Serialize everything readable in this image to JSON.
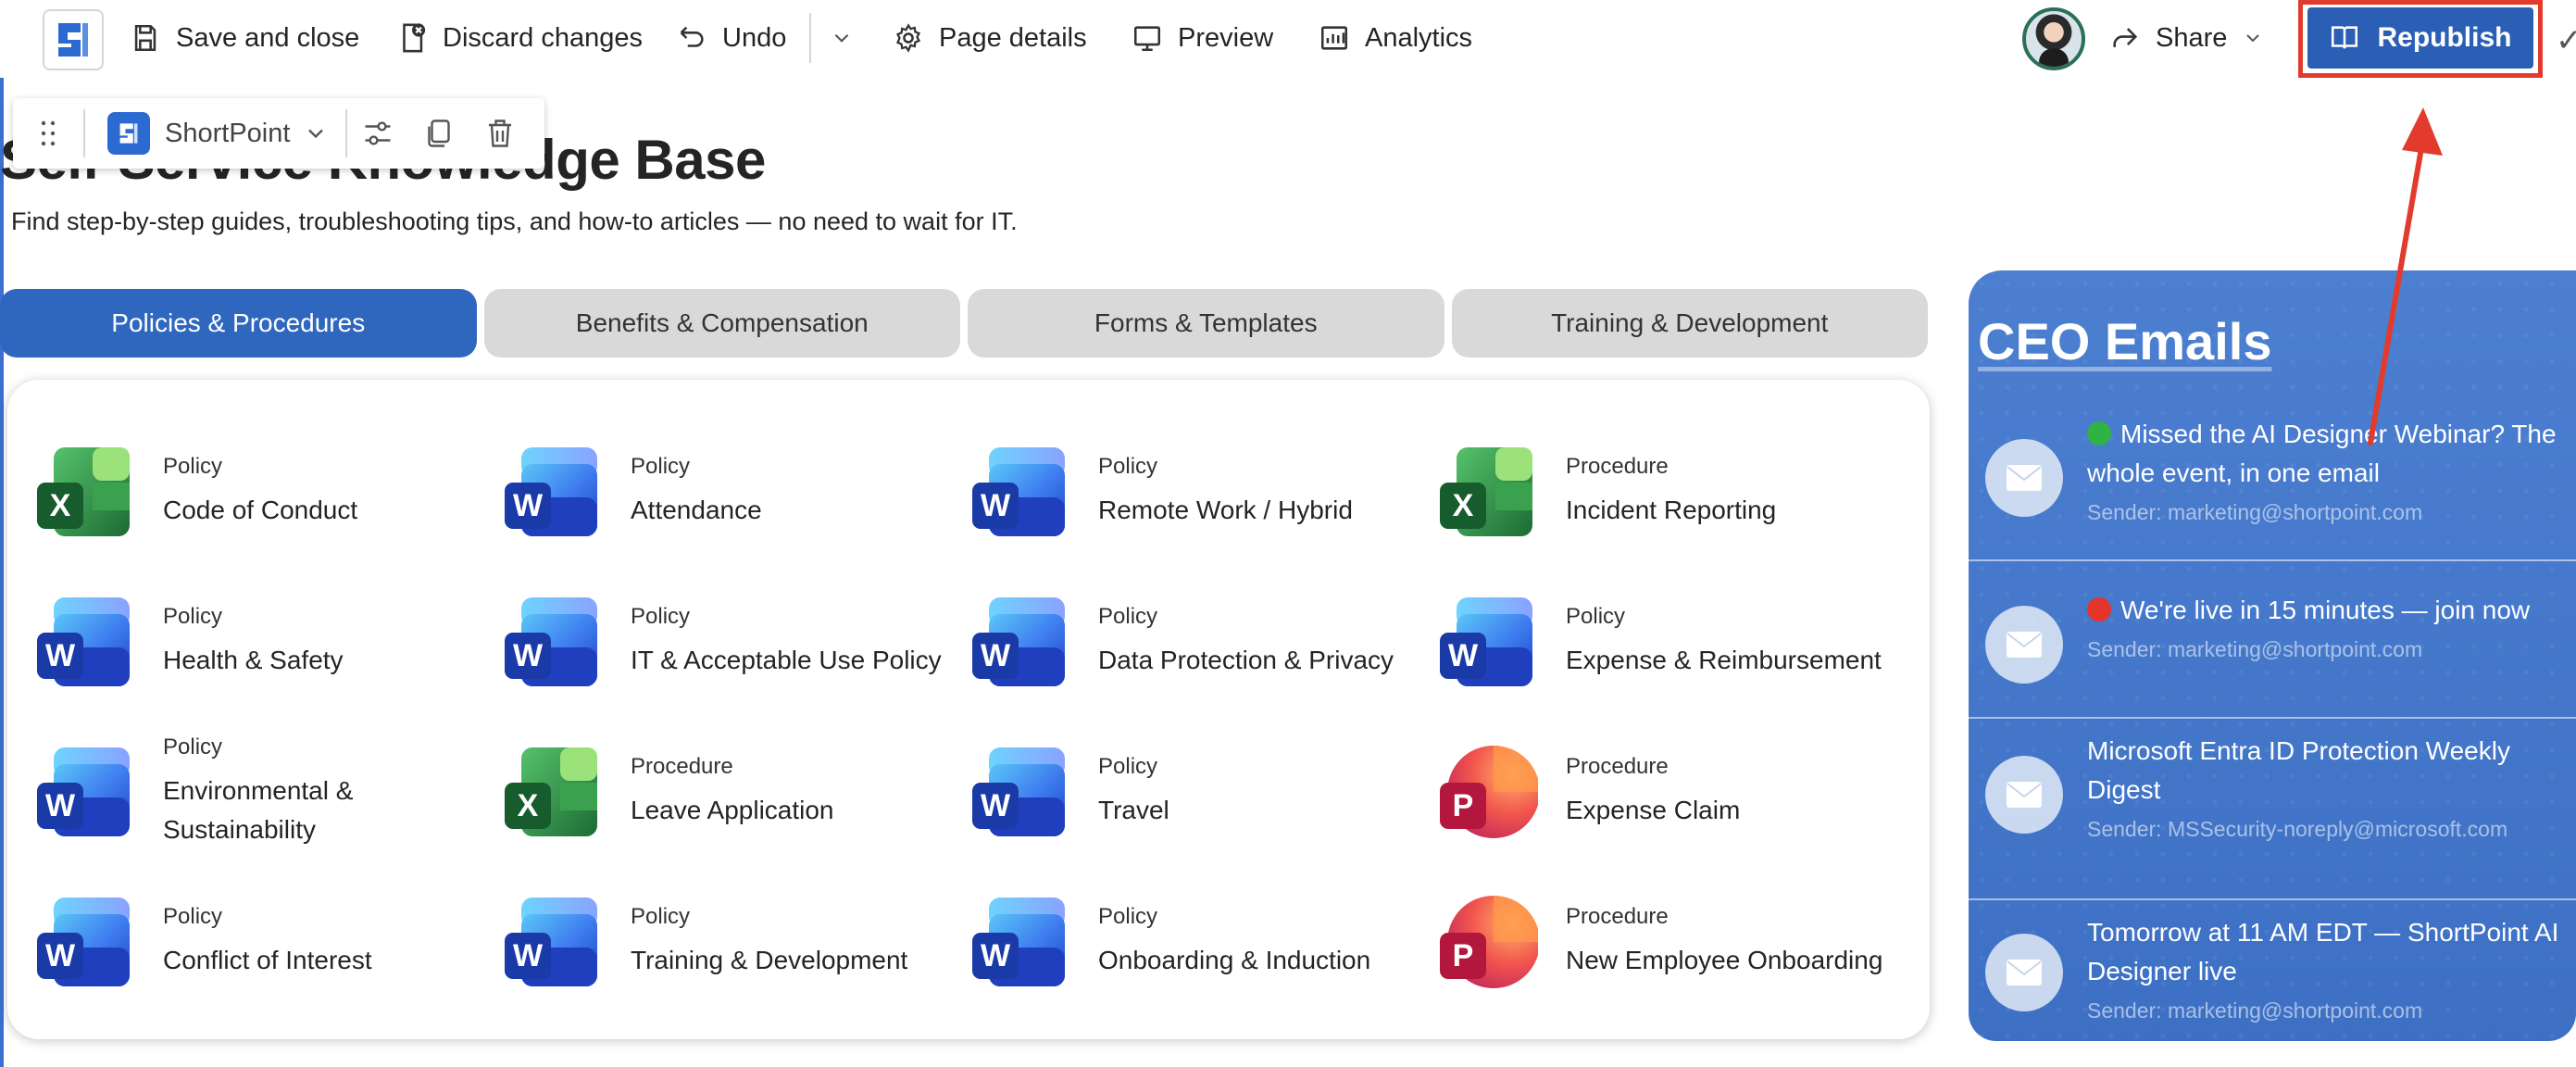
{
  "topbar": {
    "save_close": "Save and close",
    "discard": "Discard changes",
    "undo": "Undo",
    "page_details": "Page details",
    "preview": "Preview",
    "analytics": "Analytics",
    "share": "Share",
    "republish": "Republish",
    "corner_glyph": "✓"
  },
  "webpart_toolbar": {
    "brand": "ShortPoint"
  },
  "page": {
    "title": "Self-Service Knowledge Base",
    "subtitle": "Find step-by-step guides, troubleshooting tips, and how-to articles — no need to wait for IT."
  },
  "tabs": [
    {
      "label": "Policies & Procedures",
      "active": true
    },
    {
      "label": "Benefits & Compensation",
      "active": false
    },
    {
      "label": "Forms & Templates",
      "active": false
    },
    {
      "label": "Training & Development",
      "active": false
    }
  ],
  "documents": [
    {
      "type": "Policy",
      "name": "Code of Conduct",
      "app": "excel",
      "letter": "X"
    },
    {
      "type": "Policy",
      "name": "Attendance",
      "app": "word",
      "letter": "W"
    },
    {
      "type": "Policy",
      "name": "Remote Work / Hybrid",
      "app": "word",
      "letter": "W"
    },
    {
      "type": "Procedure",
      "name": "Incident Reporting",
      "app": "excel",
      "letter": "X"
    },
    {
      "type": "Policy",
      "name": "Health & Safety",
      "app": "word",
      "letter": "W"
    },
    {
      "type": "Policy",
      "name": "IT & Acceptable Use Policy",
      "app": "word",
      "letter": "W"
    },
    {
      "type": "Policy",
      "name": "Data Protection & Privacy",
      "app": "word",
      "letter": "W"
    },
    {
      "type": "Policy",
      "name": "Expense & Reimbursement",
      "app": "word",
      "letter": "W"
    },
    {
      "type": "Policy",
      "name": "Environmental & Sustainability",
      "app": "word",
      "letter": "W"
    },
    {
      "type": "Procedure",
      "name": "Leave Application",
      "app": "excel",
      "letter": "X"
    },
    {
      "type": "Policy",
      "name": "Travel",
      "app": "word",
      "letter": "W"
    },
    {
      "type": "Procedure",
      "name": "Expense Claim",
      "app": "powerpoint",
      "letter": "P"
    },
    {
      "type": "Policy",
      "name": "Conflict of Interest",
      "app": "word",
      "letter": "W"
    },
    {
      "type": "Policy",
      "name": "Training & Development",
      "app": "word",
      "letter": "W"
    },
    {
      "type": "Policy",
      "name": "Onboarding & Induction",
      "app": "word",
      "letter": "W"
    },
    {
      "type": "Procedure",
      "name": "New Employee Onboarding",
      "app": "powerpoint",
      "letter": "P"
    }
  ],
  "ceo_emails": {
    "title": "CEO Emails",
    "emails": [
      {
        "dot": "#2fb344",
        "subject": "Missed the AI Designer Webinar? The whole event, in one email",
        "sender": "Sender: marketing@shortpoint.com"
      },
      {
        "dot": "#e5342b",
        "subject": "We're live in 15 minutes — join now",
        "sender": "Sender: marketing@shortpoint.com"
      },
      {
        "dot": "",
        "subject": "Microsoft Entra ID Protection Weekly Digest",
        "sender": "Sender: MSSecurity-noreply@microsoft.com"
      },
      {
        "dot": "",
        "subject": "Tomorrow at 11 AM EDT — ShortPoint AI Designer live",
        "sender": "Sender: marketing@shortpoint.com"
      }
    ]
  },
  "colors": {
    "accent": "#2f67bf",
    "republish": "#2b5fb5",
    "annotation": "#e23b2e",
    "ceo_panel": "#4577c9"
  }
}
